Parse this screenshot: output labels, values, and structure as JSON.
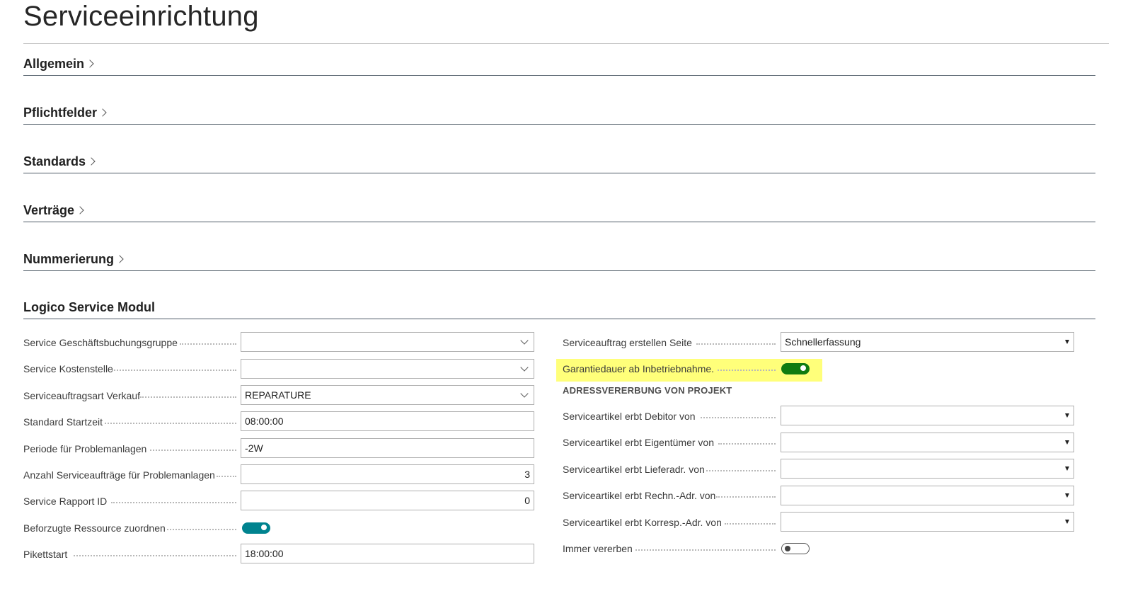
{
  "page": {
    "title": "Serviceeinrichtung"
  },
  "sections": [
    {
      "label": "Allgemein"
    },
    {
      "label": "Pflichtfelder"
    },
    {
      "label": "Standards"
    },
    {
      "label": "Verträge"
    },
    {
      "label": "Nummerierung"
    }
  ],
  "logico": {
    "title": "Logico Service Modul",
    "left_fields": [
      {
        "label": "Service Geschäftsbuchungsgruppe",
        "value": ""
      },
      {
        "label": "Service Kostenstelle",
        "value": ""
      },
      {
        "label": "Serviceauftragsart Verkauf",
        "value": "REPARATURE"
      },
      {
        "label": "Standard Startzeit",
        "value": "08:00:00"
      },
      {
        "label": "Periode für Problemanlagen",
        "value": "-2W"
      },
      {
        "label": "Anzahl Serviceaufträge für Problemanlagen",
        "value": "3"
      },
      {
        "label": "Service Rapport ID",
        "value": "0"
      },
      {
        "label": "Beforzugte Ressource zuordnen",
        "value": true
      },
      {
        "label": "Pikettstart",
        "value": "18:00:00"
      }
    ],
    "right_fields": {
      "order_page": {
        "label": "Serviceauftrag erstellen Seite",
        "value": "Schnellerfassung"
      },
      "warranty": {
        "label": "Garantiedauer ab Inbetriebnahme.",
        "value": true,
        "highlight_color": "#ffff7a"
      },
      "group_caption": "ADRESSVERERBUNG VON PROJEKT",
      "inherit_customer": {
        "label": "Serviceartikel erbt Debitor von",
        "value": ""
      },
      "inherit_owner": {
        "label": "Serviceartikel erbt Eigentümer von",
        "value": ""
      },
      "inherit_ship": {
        "label": "Serviceartikel erbt Lieferadr. von",
        "value": ""
      },
      "inherit_bill": {
        "label": "Serviceartikel erbt Rechn.-Adr. von",
        "value": ""
      },
      "inherit_corr": {
        "label": "Serviceartikel erbt Korresp.-Adr. von",
        "value": ""
      },
      "always_inherit": {
        "label": "Immer vererben",
        "value": false
      }
    }
  },
  "colors": {
    "toggle_teal": "#00838f",
    "toggle_green": "#107c10",
    "section_rule": "#4d5a66"
  }
}
